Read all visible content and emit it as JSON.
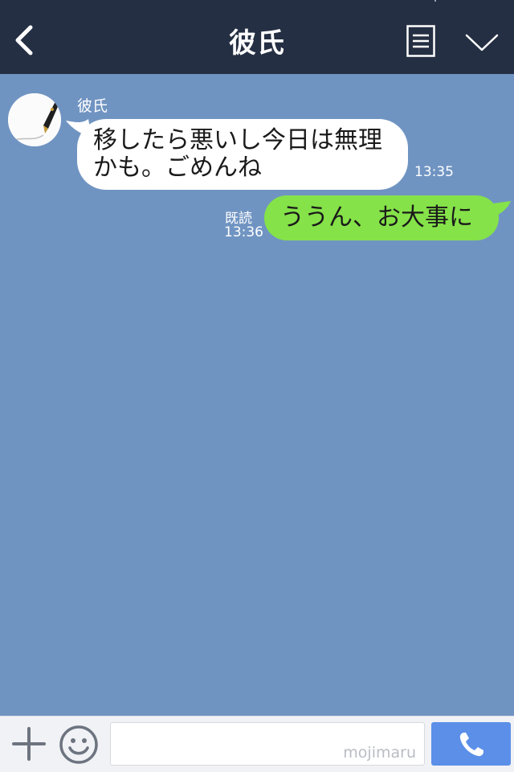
{
  "header": {
    "title": "彼氏",
    "back_icon": "chevron-left-icon",
    "notes_icon": "notes-icon",
    "menu_icon": "chevron-down-icon",
    "background": "#252f43"
  },
  "chat": {
    "background": "#7094c2",
    "messages": [
      {
        "direction": "incoming",
        "sender": "彼氏",
        "lines": [
          "移したら悪いし今日は無理",
          "かも。ごめんね"
        ],
        "time": "13:35",
        "bubble_color": "#ffffff"
      },
      {
        "direction": "outgoing",
        "text": "ううん、お大事に",
        "read_label": "既読",
        "time": "13:36",
        "bubble_color": "#85e249"
      }
    ]
  },
  "composer": {
    "plus_icon": "plus-icon",
    "emoji_icon": "smiley-icon",
    "input_value": "",
    "watermark": "mojimaru",
    "call_icon": "phone-icon",
    "call_color": "#5b8fe8"
  }
}
